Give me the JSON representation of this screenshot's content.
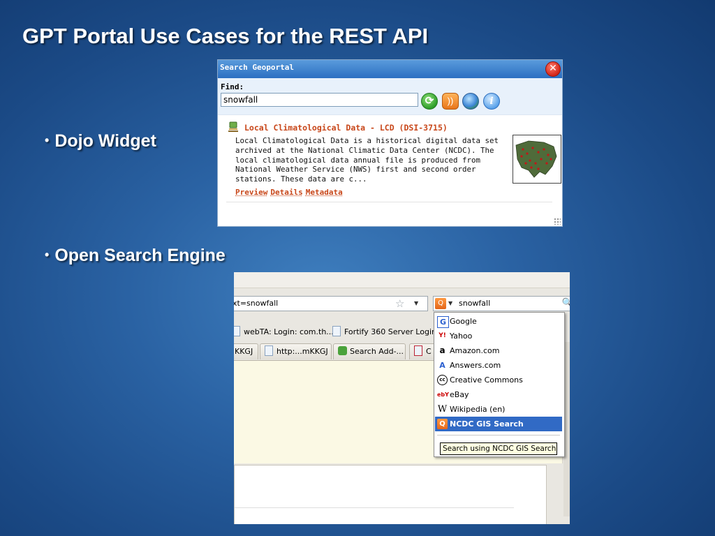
{
  "slide": {
    "title": "GPT Portal Use Cases for the REST API",
    "bullets": [
      "Dojo Widget",
      "Open Search Engine"
    ],
    "bullet_char": "•"
  },
  "widget": {
    "title": "Search Geoportal",
    "close_glyph": "✕",
    "find_label": "Find:",
    "search_value": "snowfall",
    "icons": [
      "refresh-icon",
      "rss-icon",
      "globe-icon",
      "info-icon"
    ],
    "result": {
      "title": "Local Climatological Data - LCD (DSI-3715)",
      "abstract": "Local Climatological Data is a historical digital data set archived at the National Climatic Data Center (NCDC). The local climatological data annual file is produced from National Weather Service (NWS) first and second order stations. These data are c...",
      "links": [
        "Preview",
        "Details",
        "Metadata"
      ]
    }
  },
  "browser": {
    "url_fragment": "xt=snowfall",
    "search_value": "snowfall",
    "bookmarks": [
      "webTA: Login: com.th...",
      "Fortify 360 Server Login"
    ],
    "tabs": [
      "KKGJ",
      "http:...mKKGJ",
      "Search Add-...",
      "C"
    ],
    "engines": [
      {
        "name": "Google",
        "icon": "google-icon"
      },
      {
        "name": "Yahoo",
        "icon": "yahoo-icon"
      },
      {
        "name": "Amazon.com",
        "icon": "amazon-icon"
      },
      {
        "name": "Answers.com",
        "icon": "answers-icon"
      },
      {
        "name": "Creative Commons",
        "icon": "creative-commons-icon"
      },
      {
        "name": "eBay",
        "icon": "ebay-icon"
      },
      {
        "name": "Wikipedia (en)",
        "icon": "wikipedia-icon"
      },
      {
        "name": "NCDC GIS Search",
        "icon": "ncdc-search-icon"
      }
    ],
    "tooltip": "Search using NCDC GIS Search"
  },
  "colors": {
    "link_orange": "#c8471a",
    "selection_blue": "#316ac5",
    "titlebar_blue": "#2b6fc2"
  }
}
